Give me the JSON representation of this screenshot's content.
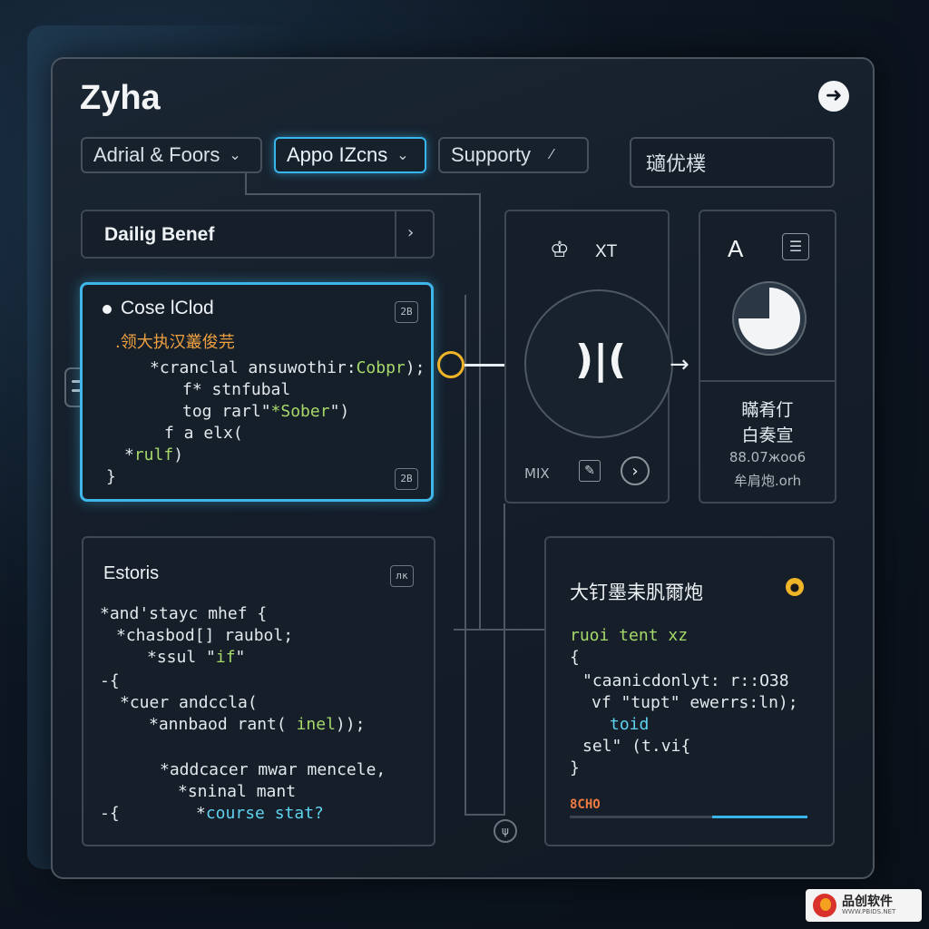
{
  "app": {
    "title": "Zyha"
  },
  "toolbar": {
    "dropdowns": [
      {
        "label": "Adrial & Foors"
      },
      {
        "label": "Appo IZcns"
      },
      {
        "label": "Supporty"
      }
    ],
    "search_text": "瓋优樸"
  },
  "nav_panel": {
    "label": "Dailig Benef"
  },
  "code_cloud": {
    "title": "Cose lClod",
    "badge_top": "2В",
    "badge_bottom": "2В",
    "comment": ".领大执汉叢俊芫",
    "lines": [
      {
        "pre": "*cranclal ansuwothir:",
        "hl": "Cobpr",
        "post": ");"
      },
      {
        "pre": "f* stnfubal",
        "hl": "",
        "post": ""
      },
      {
        "pre": "tog rarl\"",
        "hl": "*Sober",
        "post": "\")"
      },
      {
        "pre": "f a elx(",
        "hl": "",
        "post": ""
      },
      {
        "pre": "*",
        "hl": "rulf",
        "post": ")"
      },
      {
        "pre": "}",
        "hl": "",
        "post": ""
      }
    ]
  },
  "mix_panel": {
    "header": "XT",
    "footer_label": "MIX"
  },
  "stats_panel": {
    "letter": "A",
    "pie_fraction": 0.75,
    "line1": "瞞肴仃",
    "line2": "白奏宣",
    "value": "88.07жоо6",
    "footer": "牟肩炮.orh"
  },
  "estoris_panel": {
    "title": "Estoris",
    "badge": "лк",
    "lines": [
      {
        "text": "*and'stayc mhef {",
        "hl": "",
        "post": ""
      },
      {
        "text": "*chasbod[] raubol;",
        "hl": "",
        "post": ""
      },
      {
        "text": "*ssul \"",
        "hl": "if",
        "post": "\""
      },
      {
        "text": "-{",
        "hl": "",
        "post": ""
      },
      {
        "text": "*cuer andccla(",
        "hl": "",
        "post": ""
      },
      {
        "text": "*annbaod rant( ",
        "hl": "inel",
        "post": "));"
      },
      {
        "text": "",
        "hl": "",
        "post": ""
      },
      {
        "text": "*addcacer mwar mencele,",
        "hl": "",
        "post": ""
      },
      {
        "text": "*sninal mant",
        "hl": "",
        "post": ""
      },
      {
        "text": "-{",
        "hl": "",
        "post": ""
      },
      {
        "text": "*",
        "hl": "course stat?",
        "post": ""
      }
    ]
  },
  "output_panel": {
    "title": "大钉墨耒䏎爾炮",
    "lines": [
      {
        "pre": "",
        "hl": "ruoi tent xz",
        "post": ""
      },
      {
        "pre": "{",
        "hl": "",
        "post": ""
      },
      {
        "pre": "\"caanicdonlyt: r::",
        "hl": "",
        "post": "O38"
      },
      {
        "pre": "vf \"tupt\" ewerrs:",
        "hl": "",
        "post": "ln);"
      },
      {
        "pre": "",
        "hl": "toid",
        "post": ""
      },
      {
        "pre": "sel\" (t.vi{",
        "hl": "",
        "post": ""
      },
      {
        "pre": "}",
        "hl": "",
        "post": ""
      }
    ],
    "status_label": "8CHO",
    "progress": 0.4
  },
  "watermark": {
    "name": "品创软件",
    "url": "WWW.PBIDS.NET"
  },
  "colors": {
    "accent": "#38b6ec",
    "highlight": "#a6d96a",
    "warning": "#f0b429"
  }
}
